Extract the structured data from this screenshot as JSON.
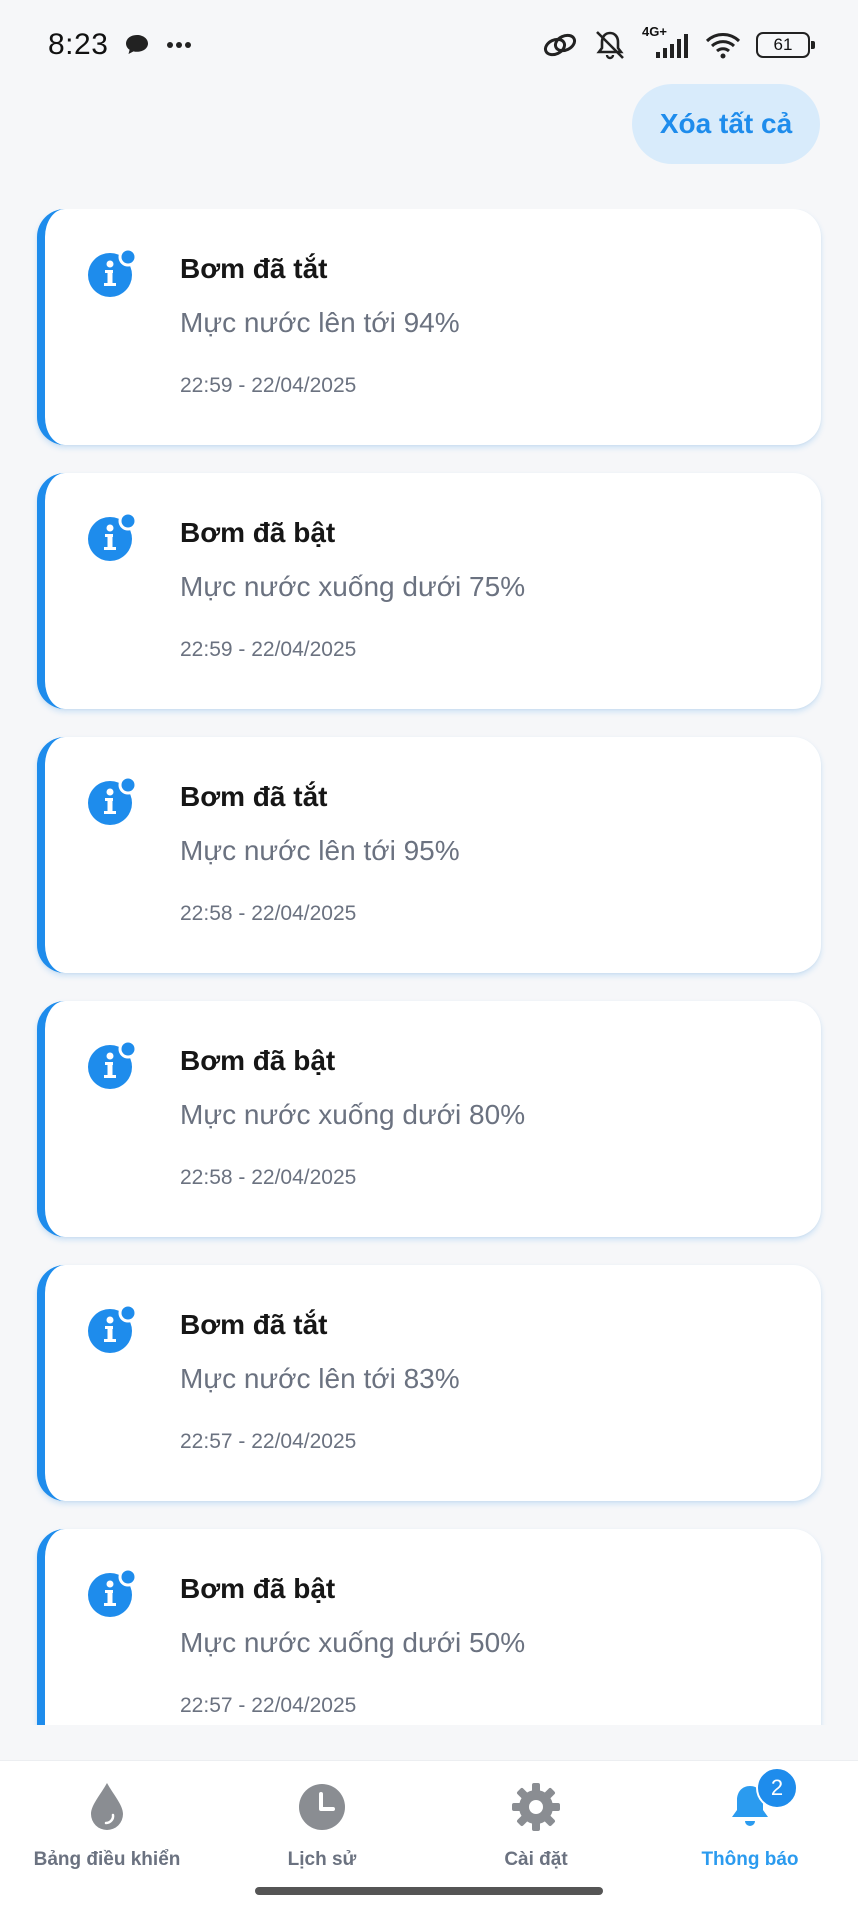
{
  "status_bar": {
    "time": "8:23",
    "icons": [
      "chat-bubble-icon",
      "more-dots-icon",
      "link-icon",
      "bell-muted-icon",
      "signal-4g-icon",
      "wifi-icon",
      "battery-icon"
    ],
    "network_label": "4G+",
    "battery_level": "61"
  },
  "header": {
    "clear_all_label": "Xóa tất cả"
  },
  "colors": {
    "accent": "#1e8cec",
    "accent_light": "#d8ebfb",
    "card_bg": "#ffffff",
    "page_bg": "#f6f7f9",
    "muted_text": "#6b7280"
  },
  "notifications": [
    {
      "title": "Bơm đã tắt",
      "message": "Mực nước lên tới 94%",
      "time": "22:59 - 22/04/2025",
      "icon": "info-icon"
    },
    {
      "title": "Bơm đã bật",
      "message": "Mực nước xuống dưới 75%",
      "time": "22:59 - 22/04/2025",
      "icon": "info-icon"
    },
    {
      "title": "Bơm đã tắt",
      "message": "Mực nước lên tới 95%",
      "time": "22:58 - 22/04/2025",
      "icon": "info-icon"
    },
    {
      "title": "Bơm đã bật",
      "message": "Mực nước xuống dưới 80%",
      "time": "22:58 - 22/04/2025",
      "icon": "info-icon"
    },
    {
      "title": "Bơm đã tắt",
      "message": "Mực nước lên tới 83%",
      "time": "22:57 - 22/04/2025",
      "icon": "info-icon"
    },
    {
      "title": "Bơm đã bật",
      "message": "Mực nước xuống dưới 50%",
      "time": "22:57 - 22/04/2025",
      "icon": "info-icon"
    }
  ],
  "bottom_nav": {
    "items": [
      {
        "label": "Bảng điều khiển",
        "icon": "water-drop-icon",
        "active": false
      },
      {
        "label": "Lịch sử",
        "icon": "clock-icon",
        "active": false
      },
      {
        "label": "Cài đặt",
        "icon": "gear-icon",
        "active": false
      },
      {
        "label": "Thông báo",
        "icon": "bell-icon",
        "active": true,
        "badge": "2"
      }
    ]
  }
}
